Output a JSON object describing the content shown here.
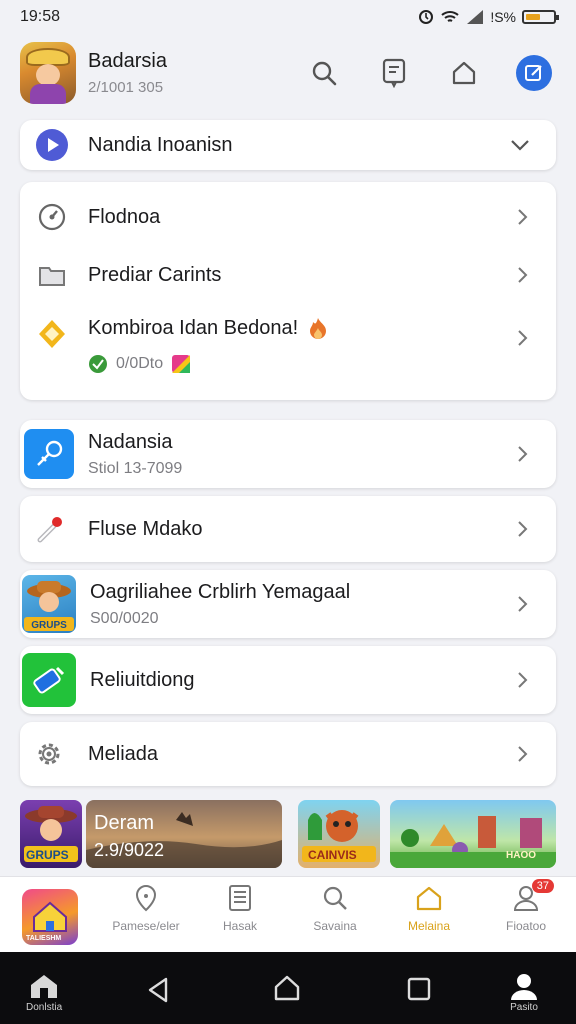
{
  "status_bar": {
    "time": "19:58",
    "battery_text": "!S%",
    "battery_level": 0.55
  },
  "header": {
    "name": "Badarsia",
    "subtitle": "2/1001 305"
  },
  "dropdown": {
    "label": "Nandia Inoanisn"
  },
  "group": {
    "items": [
      {
        "label": "Flodnoa",
        "icon": "dial-icon"
      },
      {
        "label": "Prediar Carints",
        "icon": "folder-icon"
      },
      {
        "label": "Kombiroa Idan Bedona!",
        "icon": "diamond-icon",
        "sub": "0/0Dto"
      }
    ]
  },
  "list": [
    {
      "label": "Nadansia",
      "sub": "Stiol 13-7099",
      "icon": "pen-icon"
    },
    {
      "label": "Fluse Mdako",
      "icon": "marker-icon"
    },
    {
      "label": "Oagriliahee Crblirh Yemagaal",
      "sub": "S00/0020",
      "icon": "game-character-icon"
    },
    {
      "label": "Reliuitdiong",
      "icon": "battery-app-icon"
    },
    {
      "label": "Meliada",
      "icon": "gear-icon"
    }
  ],
  "thumbnails": [
    {
      "name": "thumb-cowboy",
      "text": "GRUPS"
    },
    {
      "name": "thumb-dream",
      "title": "Deram",
      "date": "2.9/9022"
    },
    {
      "name": "thumb-fox",
      "text": "CAINVIS"
    },
    {
      "name": "thumb-village",
      "text": "HAOO"
    }
  ],
  "tabbar": {
    "tabs": [
      {
        "label": "Pamese/eler",
        "active": false
      },
      {
        "label": "Hasak",
        "active": false
      },
      {
        "label": "Savaina",
        "active": false
      },
      {
        "label": "Melaina",
        "active": true
      },
      {
        "label": "Fioatoo",
        "active": false,
        "badge": "37"
      }
    ],
    "app_tile_text": "TALIESHM"
  },
  "sysnav": {
    "home_label": "Donlstia",
    "profile_label": "Pasito"
  },
  "colors": {
    "accent_blue": "#2d6fe0",
    "active_tab": "#d9a21b",
    "badge_red": "#e53935"
  }
}
